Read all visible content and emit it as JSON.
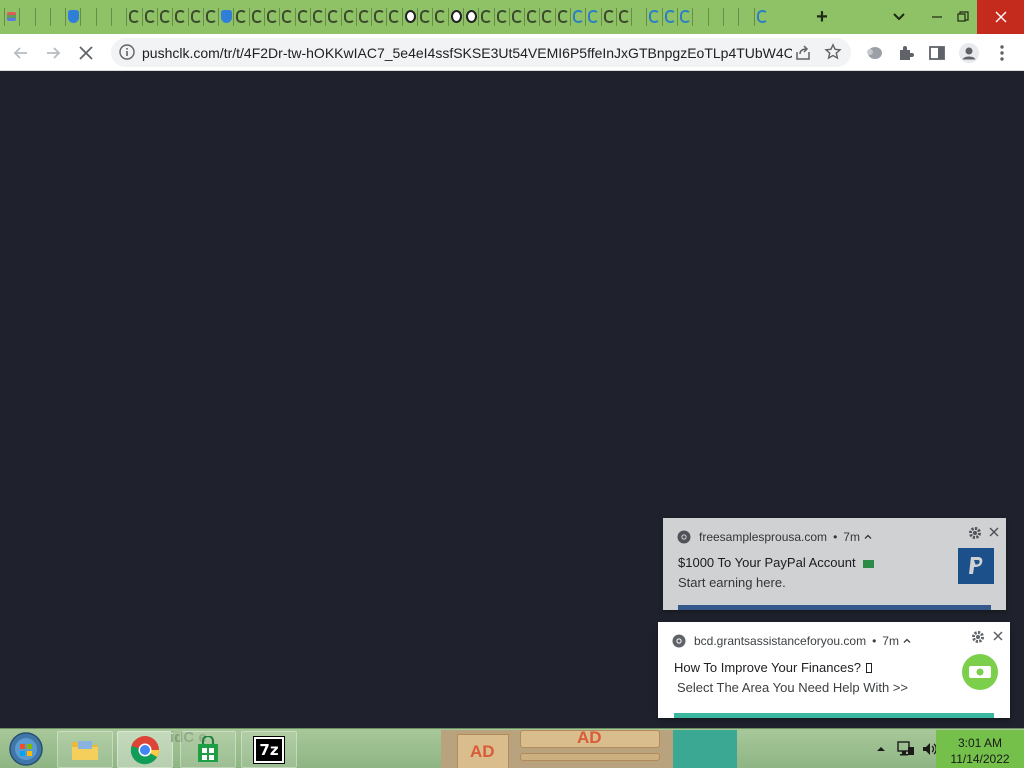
{
  "browser": {
    "tabs": [
      {
        "kind": "multi"
      },
      {
        "kind": "empty"
      },
      {
        "kind": "empty"
      },
      {
        "kind": "empty"
      },
      {
        "kind": "shield"
      },
      {
        "kind": "empty"
      },
      {
        "kind": "empty"
      },
      {
        "kind": "empty"
      },
      {
        "kind": "swirl"
      },
      {
        "kind": "swirl"
      },
      {
        "kind": "swirl"
      },
      {
        "kind": "swirl"
      },
      {
        "kind": "swirl"
      },
      {
        "kind": "swirl"
      },
      {
        "kind": "shield"
      },
      {
        "kind": "swirl"
      },
      {
        "kind": "swirl"
      },
      {
        "kind": "swirl"
      },
      {
        "kind": "swirl"
      },
      {
        "kind": "swirl"
      },
      {
        "kind": "swirl"
      },
      {
        "kind": "swirl"
      },
      {
        "kind": "swirl"
      },
      {
        "kind": "swirl"
      },
      {
        "kind": "swirl"
      },
      {
        "kind": "swirl"
      },
      {
        "kind": "face"
      },
      {
        "kind": "swirl"
      },
      {
        "kind": "swirl"
      },
      {
        "kind": "face"
      },
      {
        "kind": "face"
      },
      {
        "kind": "swirl"
      },
      {
        "kind": "swirl"
      },
      {
        "kind": "swirl"
      },
      {
        "kind": "swirl"
      },
      {
        "kind": "swirl"
      },
      {
        "kind": "swirl"
      },
      {
        "kind": "blue"
      },
      {
        "kind": "blue"
      },
      {
        "kind": "swirl"
      },
      {
        "kind": "swirl"
      },
      {
        "kind": "empty"
      },
      {
        "kind": "blue"
      },
      {
        "kind": "blue"
      },
      {
        "kind": "blue"
      },
      {
        "kind": "empty"
      },
      {
        "kind": "empty"
      },
      {
        "kind": "empty"
      },
      {
        "kind": "empty"
      },
      {
        "kind": "blue"
      }
    ],
    "new_tab_label": "+",
    "url": "pushclk.com/tr/t/4F2Dr-tw-hOKKwIAC7_5e4eI4ssfSKSE3Ut54VEMI6P5ffeInJxGTBnpgzEoTLp4TUbW4Ch..."
  },
  "colors": {
    "tabstrip": "#8fc266",
    "page_bg": "#1f222d",
    "close_red": "#c42b1c",
    "clock_bg": "#75c04a"
  },
  "notifications": [
    {
      "origin": "freesamplesprousa.com",
      "age": "7m",
      "title": "$1000 To Your PayPal Account",
      "body": "Start earning here.",
      "icon": "paypal-icon"
    },
    {
      "origin": "bcd.grantsassistanceforyou.com",
      "age": "7m",
      "title": "How To Improve Your Finances?",
      "body": "Select The Area You Need Help With >>",
      "icon": "money-icon"
    }
  ],
  "taskbar": {
    "ghost_text": "idC e",
    "ad_label_1": "AD",
    "ad_label_2": "AD",
    "sevenzip_label": "7z",
    "time": "3:01 AM",
    "date": "11/14/2022"
  }
}
